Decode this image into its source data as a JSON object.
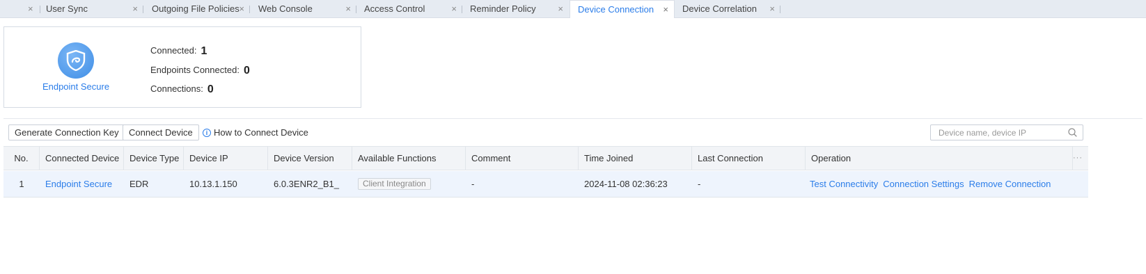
{
  "tabs": [
    {
      "label": "User Sync"
    },
    {
      "label": "Outgoing File Policies"
    },
    {
      "label": "Web Console"
    },
    {
      "label": "Access Control"
    },
    {
      "label": "Reminder Policy"
    },
    {
      "label": "Device Connection",
      "active": true
    },
    {
      "label": "Device Correlation"
    }
  ],
  "tab_close_glyph": "×",
  "summary": {
    "device_name": "Endpoint Secure",
    "stats": [
      {
        "label": "Connected:",
        "value": "1"
      },
      {
        "label": "Endpoints Connected:",
        "value": "0"
      },
      {
        "label": "Connections:",
        "value": "0"
      }
    ]
  },
  "toolbar": {
    "generate_key_label": "Generate Connection Key",
    "connect_device_label": "Connect Device",
    "help_link_label": "How to Connect Device",
    "search_placeholder": "Device name, device IP"
  },
  "table": {
    "columns": [
      "No.",
      "Connected Device",
      "Device Type",
      "Device IP",
      "Device Version",
      "Available Functions",
      "Comment",
      "Time Joined",
      "Last Connection",
      "Operation"
    ],
    "rows": [
      {
        "no": "1",
        "connected_device": "Endpoint Secure",
        "device_type": "EDR",
        "device_ip": "10.13.1.150",
        "device_version": "6.0.3ENR2_B1_",
        "available_functions": "Client Integration",
        "comment": "-",
        "time_joined": "2024-11-08 02:36:23",
        "last_connection": "-",
        "operations": [
          "Test Connectivity",
          "Connection Settings",
          "Remove Connection"
        ]
      }
    ]
  },
  "colors": {
    "accent": "#2b7de9",
    "tabbar_bg": "#e6ebf2",
    "row_highlight": "#eef4fd"
  }
}
